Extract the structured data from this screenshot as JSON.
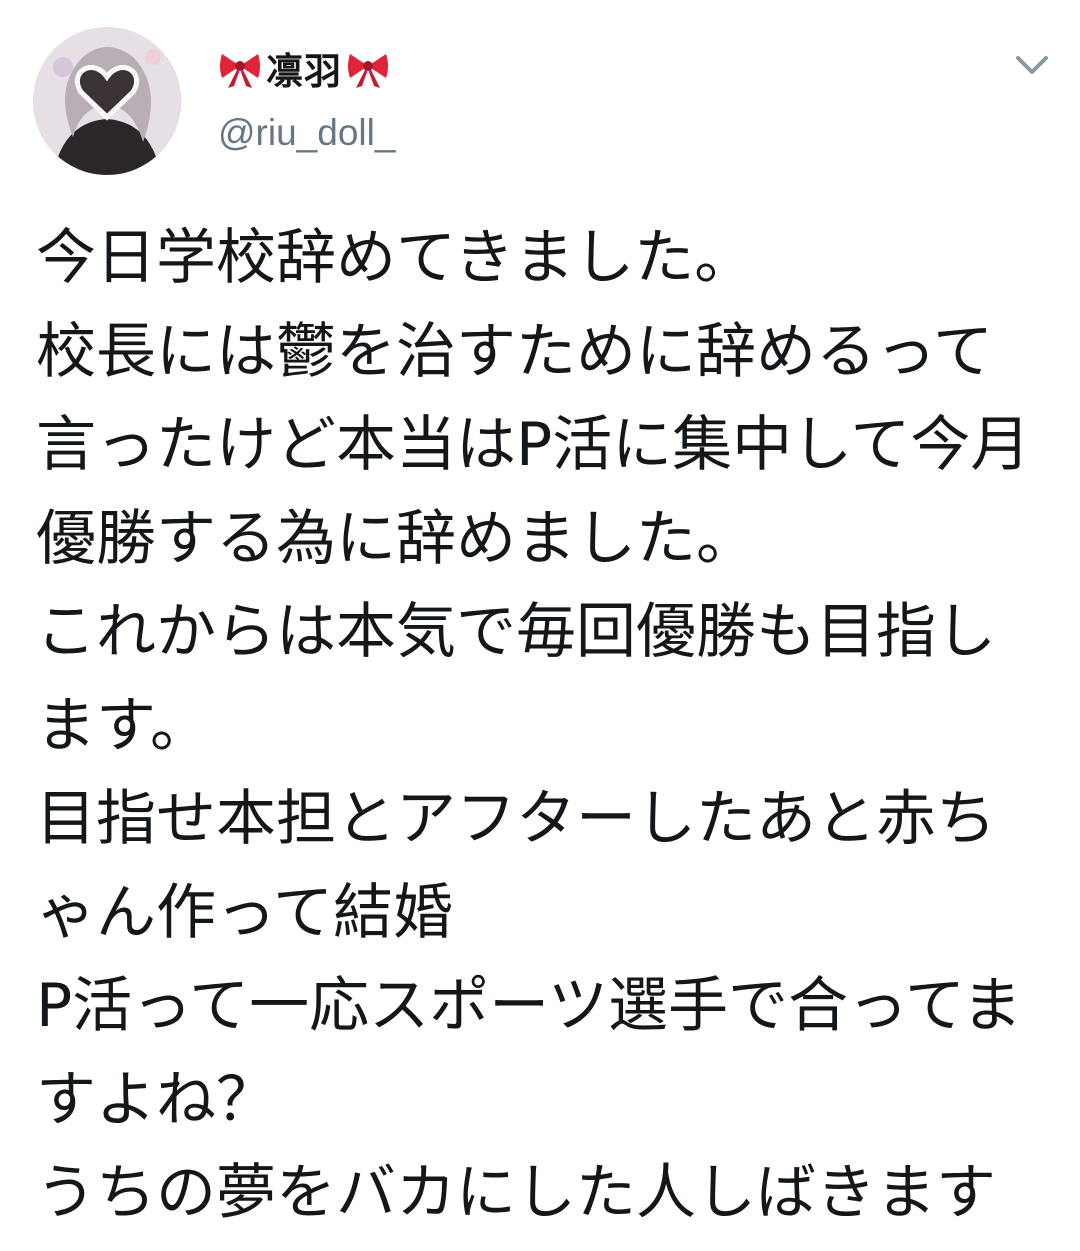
{
  "user": {
    "display_name": "凛羽",
    "handle": "@riu_doll_",
    "name_decoration_icon": "ribbon-bow-icon",
    "bow_color": "#e0243a"
  },
  "menu": {
    "icon": "chevron-down-icon"
  },
  "tweet": {
    "lines": [
      "今日学校辞めてきました。",
      "校長には鬱を治すために辞めるって",
      "言ったけど本当はP活に集中して今月",
      "優勝する為に辞めました。",
      "これからは本気で毎回優勝も目指し",
      "ます。",
      "目指せ本担とアフターしたあと赤ち",
      "ゃん作って結婚",
      "P活って一応スポーツ選手で合ってま",
      "すよね？",
      "うちの夢をバカにした人しばきます"
    ]
  },
  "colors": {
    "text": "#14171a",
    "secondary": "#657786",
    "background": "#ffffff"
  }
}
